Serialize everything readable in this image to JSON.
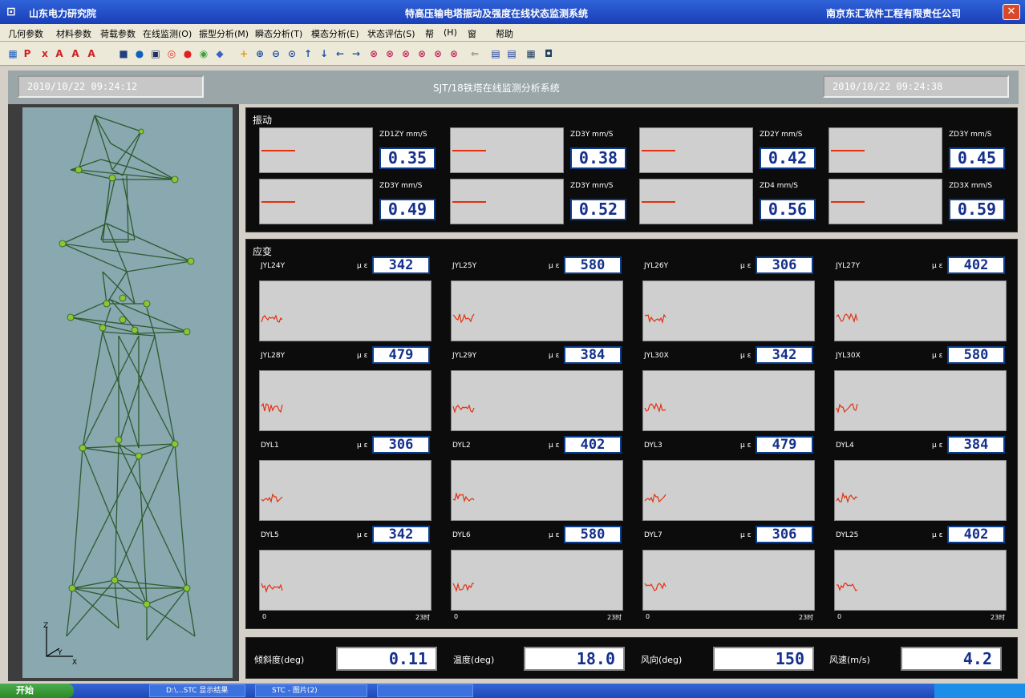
{
  "window": {
    "left_title": "山东电力研究院",
    "title": "特高压输电塔振动及强度在线状态监测系统",
    "company": "南京东汇软件工程有限责任公司"
  },
  "menu": [
    "几何参数",
    "材料参数",
    "荷载参数",
    "在线监测(O)",
    "振型分析(M)",
    "瞬态分析(T)",
    "模态分析(E)",
    "状态评估(S)",
    "帮",
    "(H)",
    "窗",
    "帮助"
  ],
  "header": {
    "left_time": "2010/10/22 09:24:12",
    "system_title": "SJT/18铁塔在线监测分析系统",
    "right_time": "2010/10/22 09:24:38"
  },
  "vibration": {
    "title": "振动",
    "sensors": [
      {
        "label": "ZD1ZY mm/S",
        "value": "0.35"
      },
      {
        "label": "ZD3Y mm/S",
        "value": "0.38"
      },
      {
        "label": "ZD2Y mm/S",
        "value": "0.42"
      },
      {
        "label": "ZD3Y mm/S",
        "value": "0.45"
      },
      {
        "label": "ZD3Y mm/S",
        "value": "0.49"
      },
      {
        "label": "ZD3Y mm/S",
        "value": "0.52"
      },
      {
        "label": "ZD4  mm/S",
        "value": "0.56"
      },
      {
        "label": "ZD3X mm/S",
        "value": "0.59"
      }
    ]
  },
  "strain": {
    "title": "应变",
    "unit": "μ ε",
    "x_start": "0",
    "x_end": "23时",
    "sensors": [
      {
        "name": "JYL24Y",
        "value": "342"
      },
      {
        "name": "JYL25Y",
        "value": "580"
      },
      {
        "name": "JYL26Y",
        "value": "306"
      },
      {
        "name": "JYL27Y",
        "value": "402"
      },
      {
        "name": "JYL28Y",
        "value": "479"
      },
      {
        "name": "JYL29Y",
        "value": "384"
      },
      {
        "name": "JYL30X",
        "value": "342"
      },
      {
        "name": "JYL30X",
        "value": "580"
      },
      {
        "name": "DYL1",
        "value": "306"
      },
      {
        "name": "DYL2",
        "value": "402"
      },
      {
        "name": "DYL3",
        "value": "479"
      },
      {
        "name": "DYL4",
        "value": "384"
      },
      {
        "name": "DYL5",
        "value": "342"
      },
      {
        "name": "DYL6",
        "value": "580"
      },
      {
        "name": "DYL7",
        "value": "306"
      },
      {
        "name": "DYL25",
        "value": "402"
      }
    ]
  },
  "measurements": [
    {
      "label": "倾斜度(deg)",
      "value": "0.11"
    },
    {
      "label": "温度(deg)",
      "value": "18.0"
    },
    {
      "label": "风向(deg)",
      "value": "150"
    },
    {
      "label": "风速(m/s)",
      "value": "4.2"
    }
  ],
  "axes": {
    "z": "Z",
    "y": "Y",
    "x": "X"
  },
  "taskbar": {
    "start": "开始",
    "items": [
      "D:\\...STC  显示结果",
      "STC - 图片(2)",
      ""
    ]
  },
  "colors": {
    "trace": "#e23010",
    "digits": "#14308c",
    "panel_bg": "#0c0c0c",
    "tower": "#2e5a2e",
    "node": "#8ac830"
  }
}
